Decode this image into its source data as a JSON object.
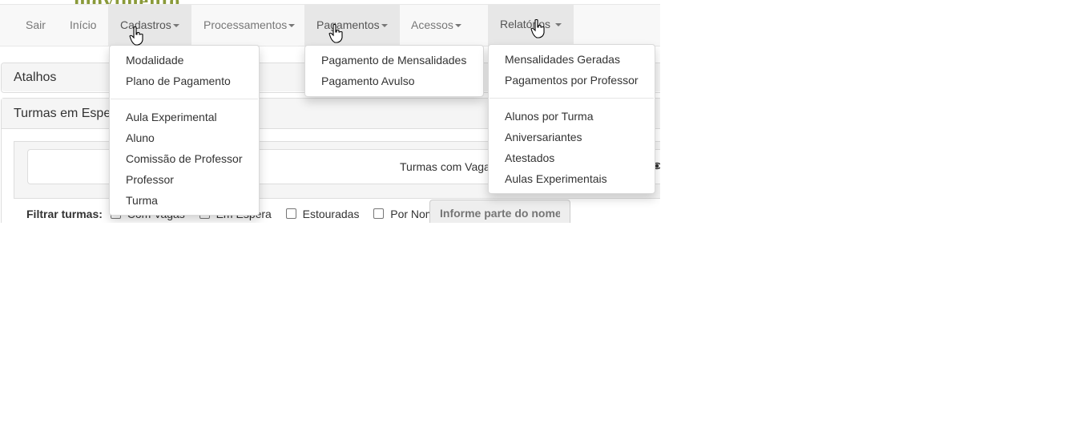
{
  "logo_text": "movimento",
  "navbar": {
    "items": [
      {
        "label": "Sair",
        "has_caret": false,
        "open": false
      },
      {
        "label": "Início",
        "has_caret": false,
        "open": false
      },
      {
        "label": "Cadastros",
        "has_caret": true,
        "open": true
      },
      {
        "label": "Processamentos",
        "has_caret": true,
        "open": false
      },
      {
        "label": "Pagamentos",
        "has_caret": true,
        "open": true
      },
      {
        "label": "Acessos",
        "has_caret": true,
        "open": false
      },
      {
        "label": "Relatórios",
        "has_caret": true,
        "open": true
      }
    ]
  },
  "panels": {
    "atalhos": {
      "title": "Atalhos"
    },
    "turmas": {
      "title": "Turmas em Espera",
      "inner_title": "Turmas com Vagas"
    }
  },
  "filter": {
    "label": "Filtrar turmas:",
    "options": [
      {
        "label": "Com Vagas",
        "checked": false
      },
      {
        "label": "Em Espera",
        "checked": false
      },
      {
        "label": "Estouradas",
        "checked": false
      },
      {
        "label": "Por Nome:",
        "checked": false
      }
    ],
    "name_placeholder": "Informe parte do nome e"
  },
  "dropdowns": {
    "cadastros": {
      "groups": [
        [
          "Modalidade",
          "Plano de Pagamento"
        ],
        [
          "Aula Experimental",
          "Aluno",
          "Comissão de Professor",
          "Professor",
          "Turma"
        ]
      ]
    },
    "pagamentos": {
      "groups": [
        [
          "Pagamento de Mensalidades",
          "Pagamento Avulso"
        ]
      ]
    },
    "relatorios": {
      "groups": [
        [
          "Mensalidades Geradas",
          "Pagamentos por Professor"
        ],
        [
          "Alunos por Turma",
          "Aniversariantes",
          "Atestados",
          "Aulas Experimentais"
        ]
      ]
    }
  }
}
